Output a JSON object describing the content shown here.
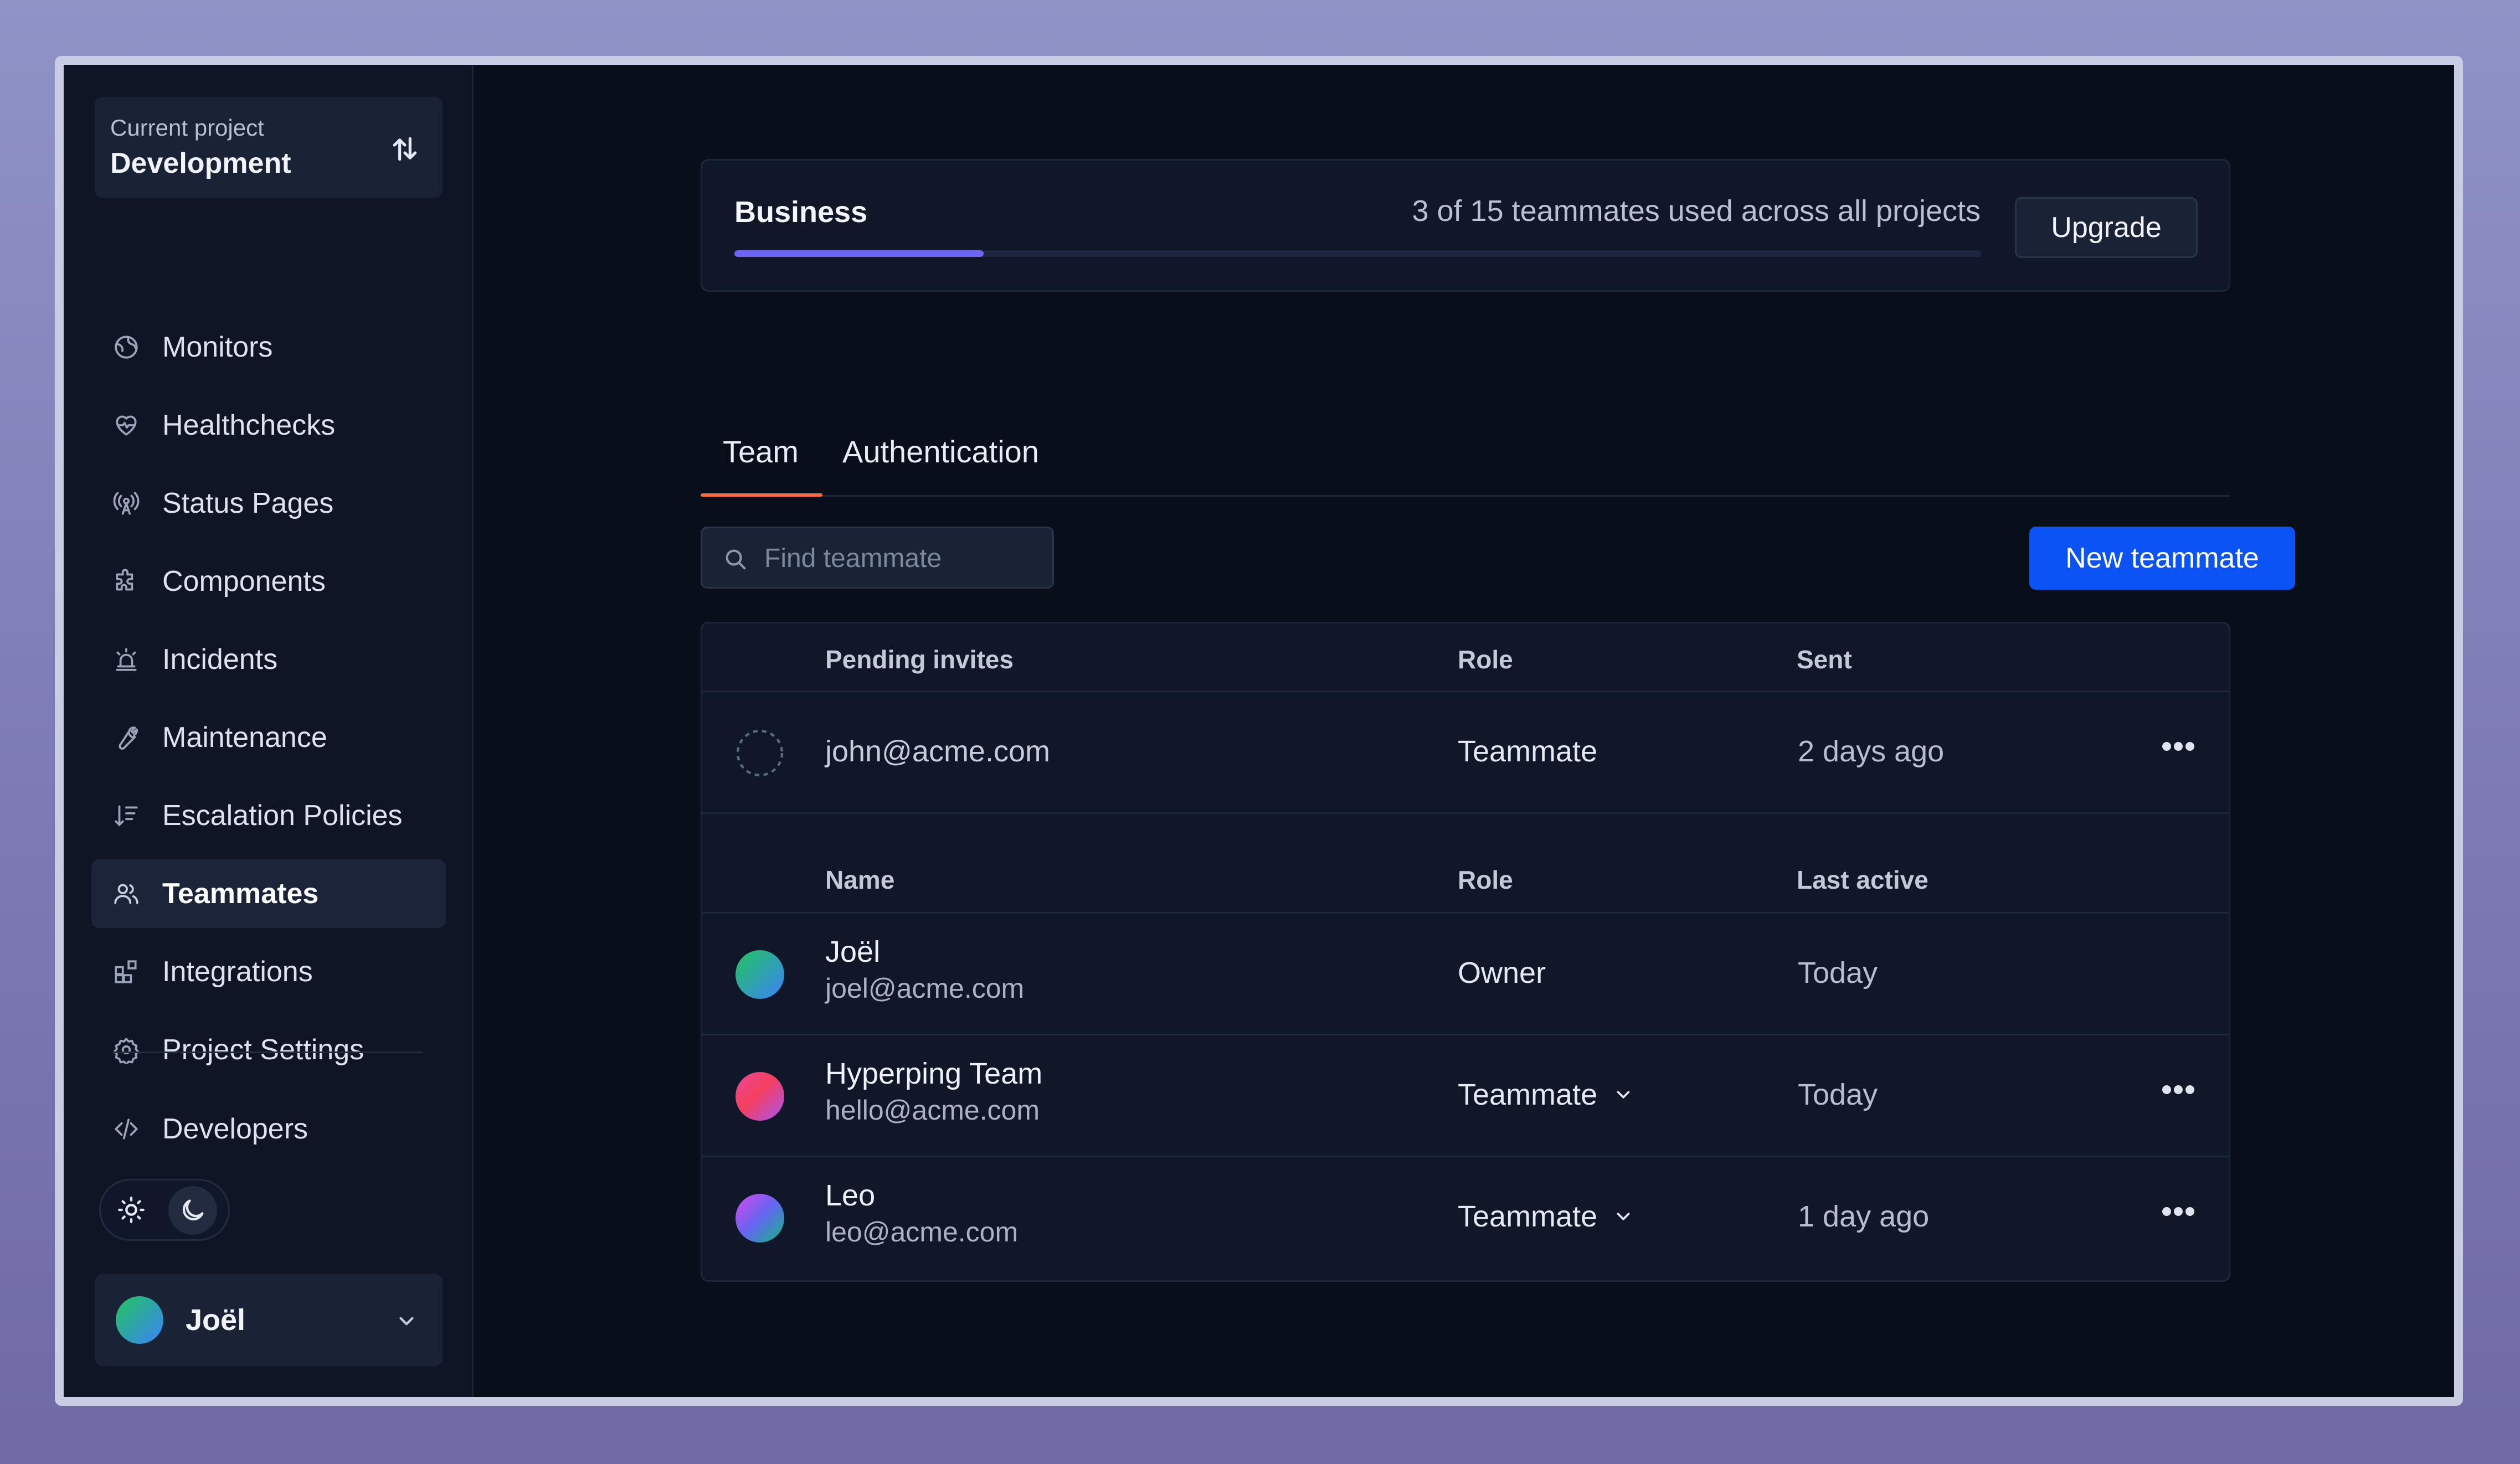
{
  "sidebar": {
    "project": {
      "label": "Current project",
      "value": "Development"
    },
    "items": [
      {
        "label": "Monitors",
        "icon": "globe-icon"
      },
      {
        "label": "Healthchecks",
        "icon": "heart-pulse-icon"
      },
      {
        "label": "Status Pages",
        "icon": "radio-tower-icon"
      },
      {
        "label": "Components",
        "icon": "puzzle-icon"
      },
      {
        "label": "Incidents",
        "icon": "siren-icon"
      },
      {
        "label": "Maintenance",
        "icon": "wrench-icon"
      },
      {
        "label": "Escalation Policies",
        "icon": "arrow-down-list-icon"
      },
      {
        "label": "Teammates",
        "icon": "users-icon",
        "active": true
      },
      {
        "label": "Integrations",
        "icon": "blocks-icon"
      },
      {
        "label": "Project Settings",
        "icon": "gear-icon"
      }
    ],
    "developers": {
      "label": "Developers",
      "icon": "code-icon"
    },
    "user": {
      "name": "Joël"
    }
  },
  "plan": {
    "name": "Business",
    "usage_text": "3 of 15 teammates used across all projects",
    "used": 3,
    "total": 15,
    "upgrade_label": "Upgrade",
    "accent": "#6d63f5"
  },
  "tabs": [
    {
      "label": "Team",
      "active": true
    },
    {
      "label": "Authentication",
      "active": false
    }
  ],
  "search": {
    "placeholder": "Find teammate",
    "value": ""
  },
  "new_teammate_label": "New teammate",
  "pending": {
    "headers": {
      "name": "Pending invites",
      "role": "Role",
      "date": "Sent"
    },
    "rows": [
      {
        "email": "john@acme.com",
        "role": "Teammate",
        "sent": "2 days ago"
      }
    ]
  },
  "members": {
    "headers": {
      "name": "Name",
      "role": "Role",
      "date": "Last active"
    },
    "rows": [
      {
        "name": "Joël",
        "email": "joel@acme.com",
        "role": "Owner",
        "last_active": "Today",
        "editable": false
      },
      {
        "name": "Hyperping Team",
        "email": "hello@acme.com",
        "role": "Teammate",
        "last_active": "Today",
        "editable": true
      },
      {
        "name": "Leo",
        "email": "leo@acme.com",
        "role": "Teammate",
        "last_active": "1 day ago",
        "editable": true
      }
    ]
  },
  "colors": {
    "primary_button": "#0b53f5",
    "tab_underline": "#ff6a3d",
    "background": "#090e1b"
  }
}
